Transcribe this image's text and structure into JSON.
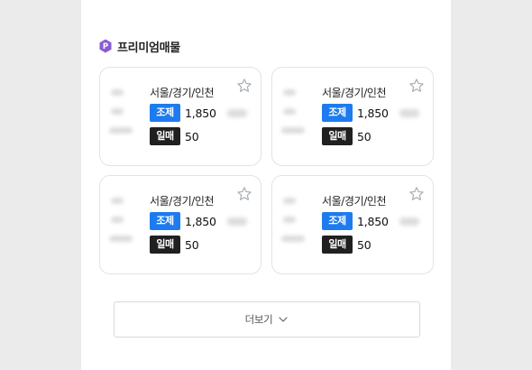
{
  "section": {
    "title": "프리미엄매물",
    "icon": "premium-p-icon",
    "icon_letter": "P",
    "icon_color": "#8a5bd6"
  },
  "listings": [
    {
      "region": "서울/경기/인천",
      "tag1": "조제",
      "value1": "1,850",
      "tag2": "일매",
      "value2": "50",
      "favorite_icon": "star-outline-icon"
    },
    {
      "region": "서울/경기/인천",
      "tag1": "조제",
      "value1": "1,850",
      "tag2": "일매",
      "value2": "50",
      "favorite_icon": "star-outline-icon"
    },
    {
      "region": "서울/경기/인천",
      "tag1": "조제",
      "value1": "1,850",
      "tag2": "일매",
      "value2": "50",
      "favorite_icon": "star-outline-icon"
    },
    {
      "region": "서울/경기/인천",
      "tag1": "조제",
      "value1": "1,850",
      "tag2": "일매",
      "value2": "50",
      "favorite_icon": "star-outline-icon"
    }
  ],
  "more_button": {
    "label": "더보기",
    "icon": "chevron-down-icon"
  },
  "colors": {
    "tag_blue": "#1e7bef",
    "tag_dark": "#202020",
    "background": "#ebebeb",
    "panel": "#ffffff"
  }
}
